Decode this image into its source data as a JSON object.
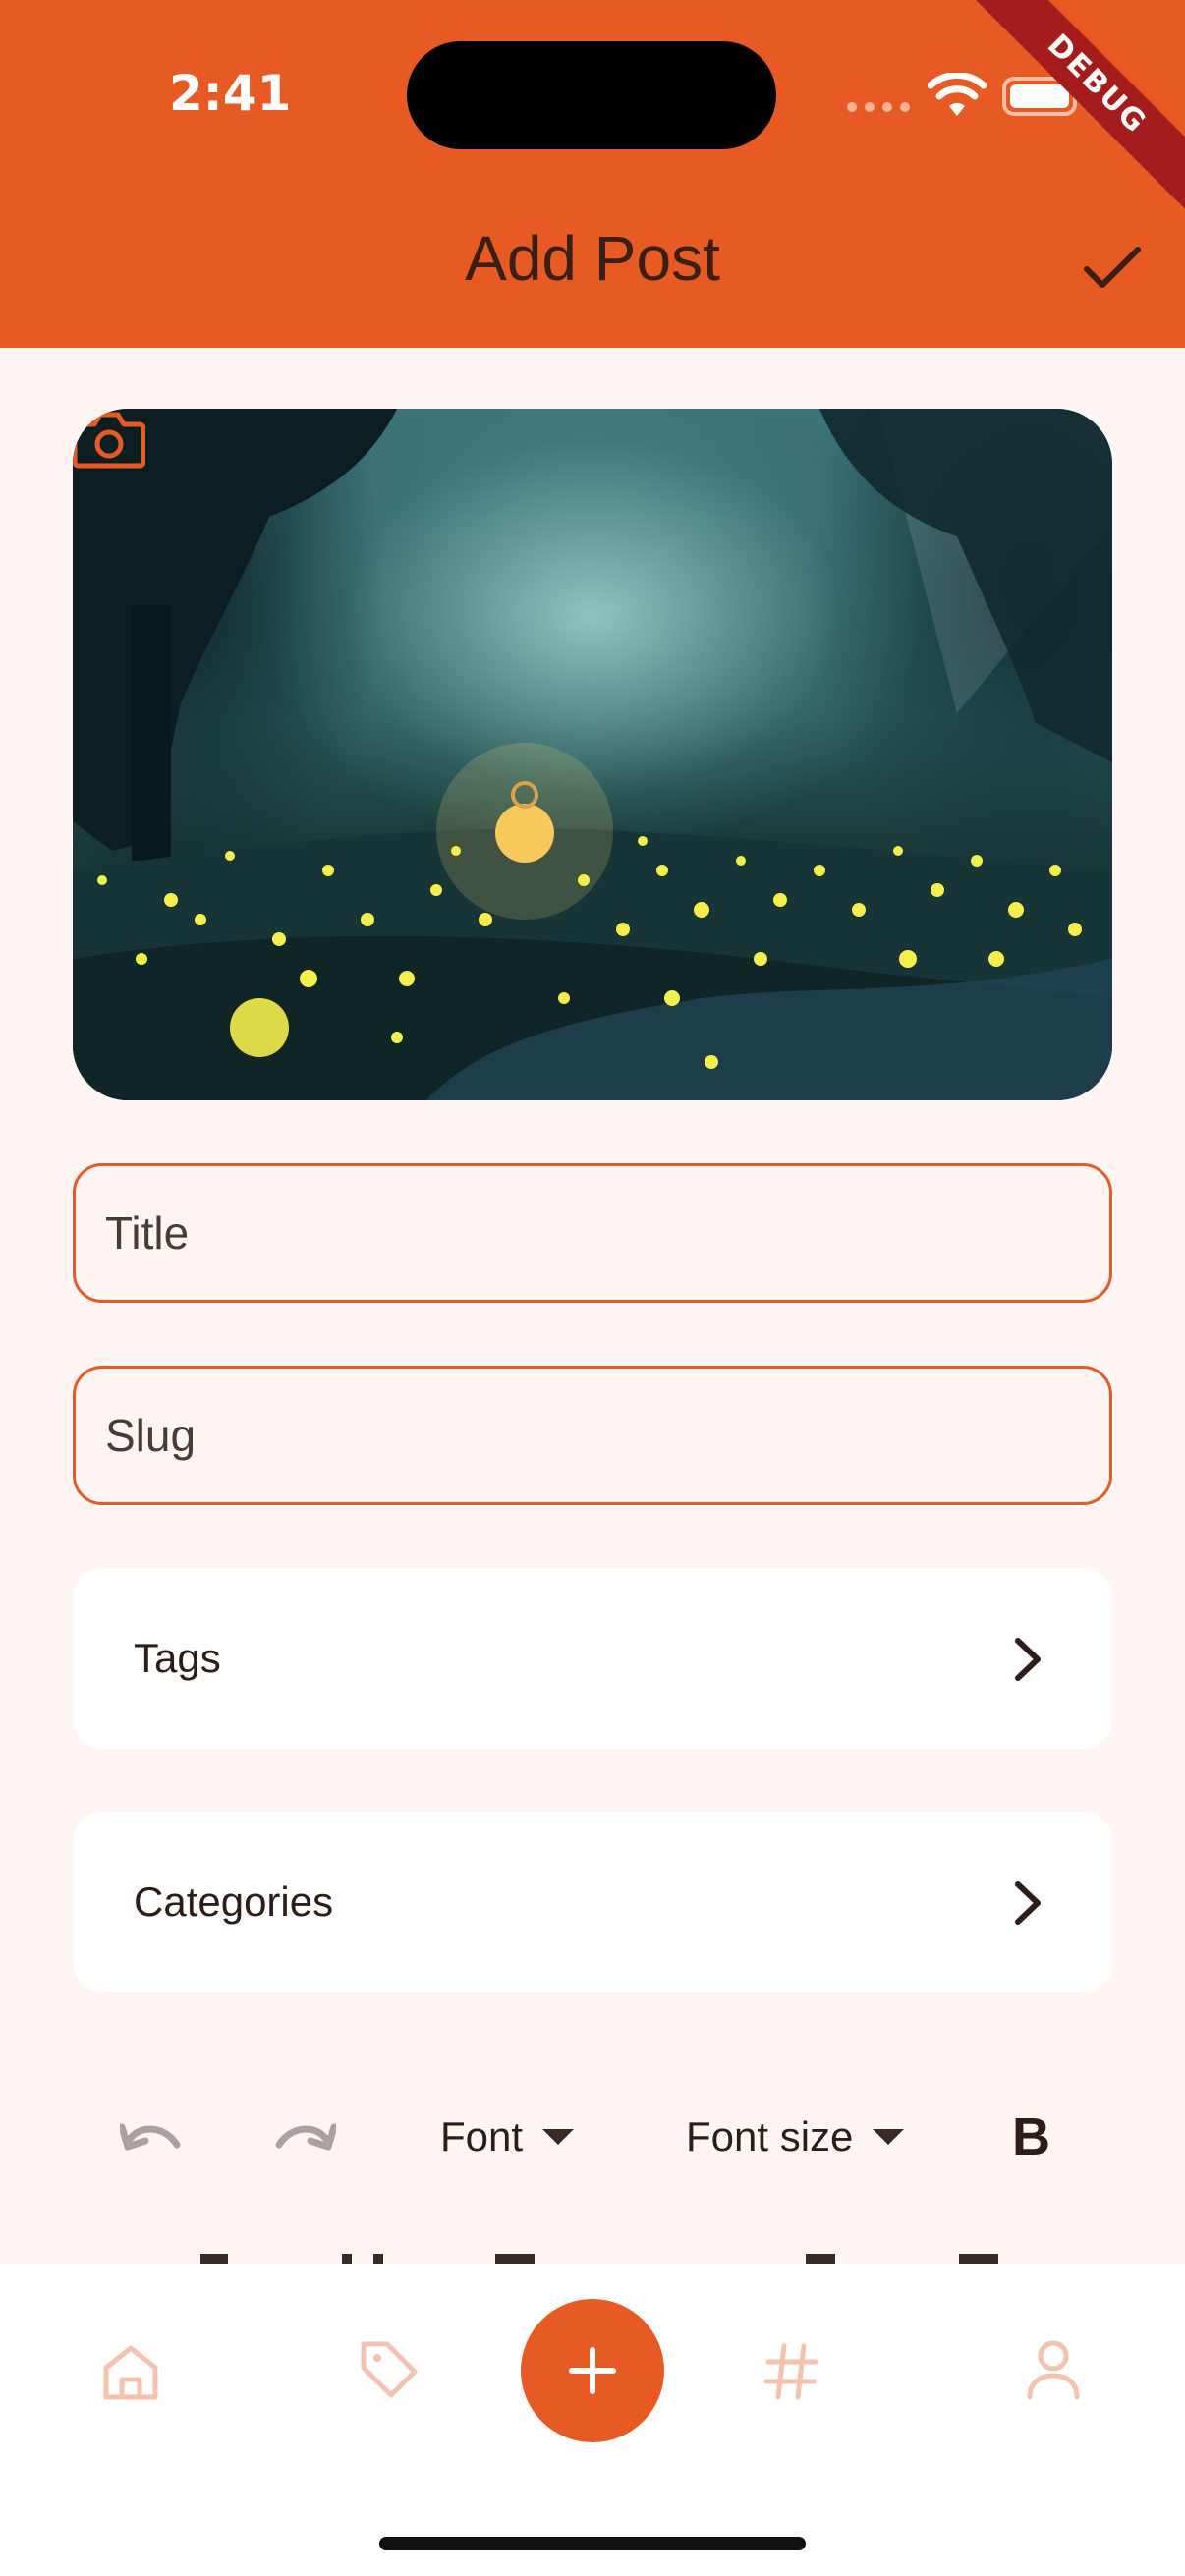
{
  "status_bar": {
    "time": "2:41",
    "debug_banner": "DEBUG"
  },
  "appbar": {
    "title": "Add Post",
    "confirm_icon": "check-icon"
  },
  "cover": {
    "alt_icon": "camera-icon"
  },
  "form": {
    "title_placeholder": "Title",
    "slug_placeholder": "Slug",
    "tags_label": "Tags",
    "categories_label": "Categories"
  },
  "toolbar": {
    "undo_icon": "undo-icon",
    "redo_icon": "redo-icon",
    "font_label": "Font",
    "font_size_label": "Font size",
    "bold_label": "B"
  },
  "bottom_nav": {
    "items": [
      "home-icon",
      "tag-icon",
      "add-icon",
      "hashtag-icon",
      "profile-icon"
    ]
  },
  "colors": {
    "accent": "#e85a23",
    "background": "#fff5f2",
    "card": "#ffffff"
  }
}
